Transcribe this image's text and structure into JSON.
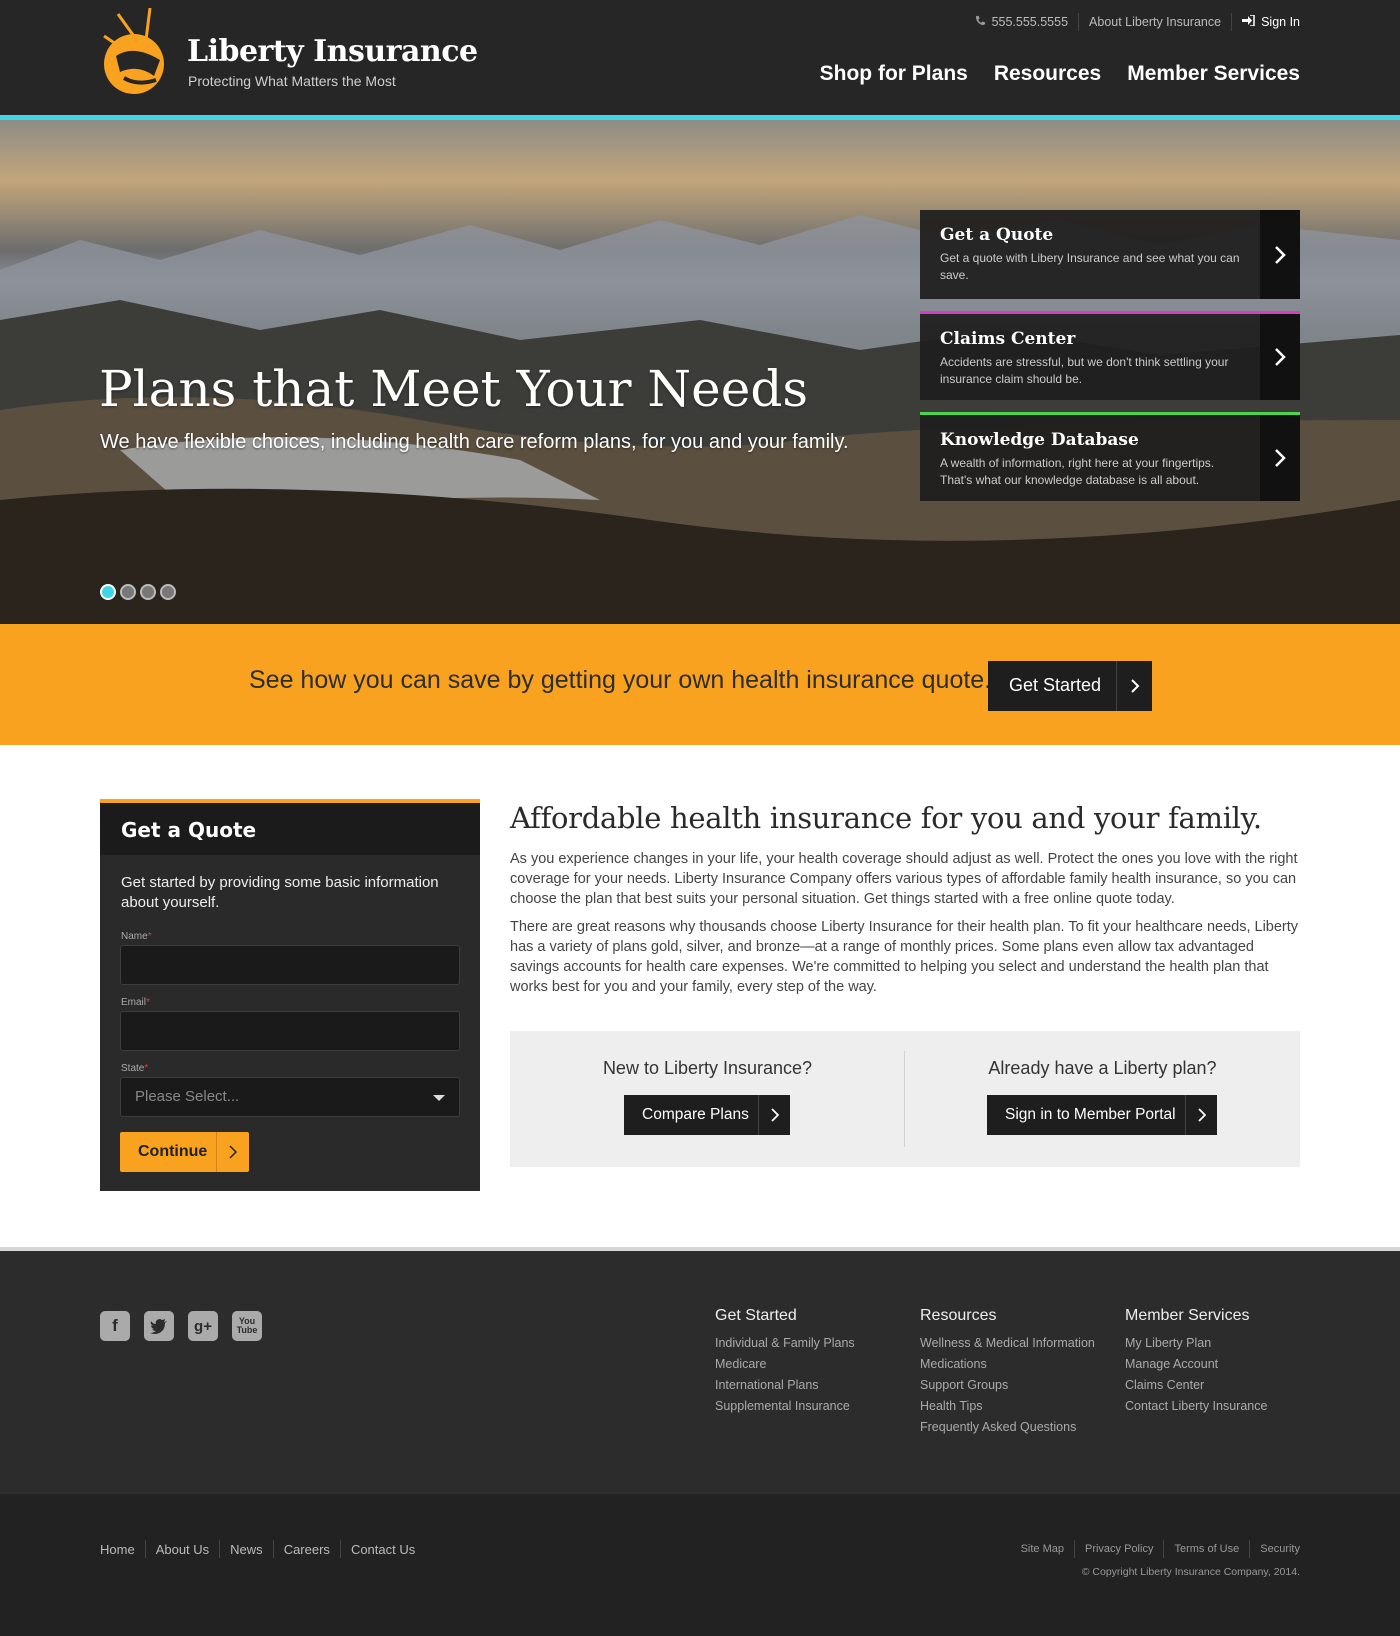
{
  "header": {
    "brand_title": "Liberty Insurance",
    "brand_tagline": "Protecting What Matters the Most",
    "phone": "555.555.5555",
    "about_link": "About Liberty Insurance",
    "sign_in": "Sign In",
    "nav": [
      "Shop for Plans",
      "Resources",
      "Member Services"
    ]
  },
  "hero": {
    "title": "Plans that Meet Your Needs",
    "subtitle": "We have flexible choices, including health care reform plans, for you and your family.",
    "slide_count": 4,
    "active_slide": 1,
    "cards": [
      {
        "title": "Get a Quote",
        "text": "Get a quote with Libery Insurance and see what you can save."
      },
      {
        "title": "Claims Center",
        "text": "Accidents are stressful, but we don't think settling your insurance claim should be."
      },
      {
        "title": "Knowledge Database",
        "text": "A wealth of information, right here at your fingertips. That's what our knowledge database is all about."
      }
    ]
  },
  "promo": {
    "text": "See how you can save by getting your own health insurance quote.",
    "button": "Get Started"
  },
  "quote_form": {
    "title": "Get a Quote",
    "intro": "Get started by providing some basic information about yourself.",
    "name_label": "Name",
    "email_label": "Email",
    "state_label": "State",
    "required_mark": "*",
    "state_placeholder": "Please Select...",
    "submit": "Continue"
  },
  "content": {
    "heading": "Affordable health insurance for you and your family.",
    "para1": "As you experience changes in your life, your health coverage should adjust as well. Protect the ones you love with the right coverage for your needs. Liberty Insurance Company offers various types of affordable family health insurance, so you can choose the plan that best suits your personal situation. Get things started with a free online quote today.",
    "para2": "There are great reasons why thousands choose Liberty Insurance for their health plan. To fit your healthcare needs, Liberty has a variety of plans gold, silver, and bronze—at a range of monthly prices. Some plans even allow tax advantaged savings accounts for health care expenses. We're committed to helping you select and understand the health plan that works best for you and your family, every step of the way.",
    "cta_new_question": "New to Liberty Insurance?",
    "cta_new_button": "Compare Plans",
    "cta_member_question": "Already have a Liberty plan?",
    "cta_member_button": "Sign in to Member Portal"
  },
  "footer": {
    "social": [
      "facebook-icon",
      "twitter-icon",
      "google-plus-icon",
      "youtube-icon"
    ],
    "columns": [
      {
        "title": "Get Started",
        "links": [
          "Individual & Family Plans",
          "Medicare",
          "International Plans",
          "Supplemental Insurance"
        ]
      },
      {
        "title": "Resources",
        "links": [
          "Wellness & Medical Information",
          "Medications",
          "Support Groups",
          "Health Tips",
          "Frequently Asked Questions"
        ]
      },
      {
        "title": "Member Services",
        "links": [
          "My Liberty Plan",
          "Manage Account",
          "Claims Center",
          "Contact Liberty Insurance"
        ]
      }
    ],
    "bottom_links": [
      "Home",
      "About Us",
      "News",
      "Careers",
      "Contact Us"
    ],
    "legal_links": [
      "Site Map",
      "Privacy Policy",
      "Terms of Use",
      "Security"
    ],
    "copyright": "© Copyright Liberty Insurance Company, 2014."
  },
  "colors": {
    "accent_orange": "#f8a21f",
    "accent_cyan": "#3fd7e6",
    "accent_pink": "#d63cc9",
    "accent_green": "#4dd44a",
    "header_bg": "#262626"
  }
}
